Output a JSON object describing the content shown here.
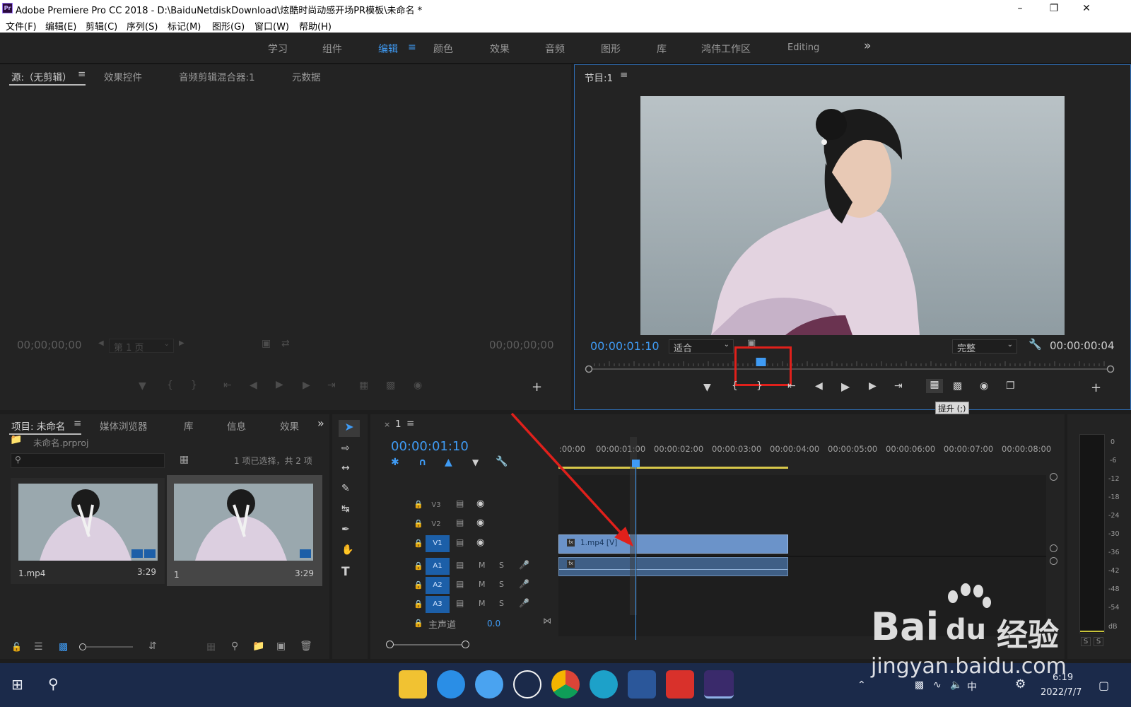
{
  "window": {
    "title": "Adobe Premiere Pro CC 2018 - D:\\BaiduNetdiskDownload\\炫酷时尚动感开场PR模板\\未命名 *",
    "app_icon": "Pr"
  },
  "menu": [
    "文件(F)",
    "编辑(E)",
    "剪辑(C)",
    "序列(S)",
    "标记(M)",
    "图形(G)",
    "窗口(W)",
    "帮助(H)"
  ],
  "workspaces": {
    "items": [
      "学习",
      "组件",
      "编辑",
      "颜色",
      "效果",
      "音频",
      "图形",
      "库",
      "鸿伟工作区",
      "Editing"
    ],
    "active": "编辑",
    "more": "»"
  },
  "source_panel": {
    "tabs": [
      "源:（无剪辑）",
      "效果控件",
      "音频剪辑混合器:1",
      "元数据"
    ],
    "tc_left": "00;00;00;00",
    "tc_right": "00;00;00;00",
    "page_select": "第 1 页",
    "add": "+"
  },
  "program_panel": {
    "title": "节目:1",
    "timecode": "00:00:01:10",
    "fit": "适合",
    "quality": "完整",
    "duration": "00:00:00:04",
    "tooltip": "提升 (;)",
    "add": "+",
    "playhead_fraction": 0.33
  },
  "project_panel": {
    "tabs": [
      "项目: 未命名",
      "媒体浏览器",
      "库",
      "信息",
      "效果"
    ],
    "file": "未命名.prproj",
    "selection_status": "1 项已选择，共 2 项",
    "search_placeholder": "",
    "items": [
      {
        "name": "1.mp4",
        "duration": "3:29"
      },
      {
        "name": "1",
        "duration": "3:29"
      }
    ]
  },
  "timeline": {
    "tab": "1",
    "timecode": "00:00:01:10",
    "ruler_labels": [
      ":00:00",
      "00:00:01:00",
      "00:00:02:00",
      "00:00:03:00",
      "00:00:04:00",
      "00:00:05:00",
      "00:00:06:00",
      "00:00:07:00",
      "00:00:08:00"
    ],
    "video_tracks": [
      "V3",
      "V2",
      "V1"
    ],
    "audio_tracks": [
      "A1",
      "A2",
      "A3"
    ],
    "m_label": "M",
    "s_label": "S",
    "master": {
      "label": "主声道",
      "value": "0.0"
    },
    "clip_video": "1.mp4 [V]",
    "clip_audio": "fx"
  },
  "meter": {
    "labels": [
      "0",
      "-6",
      "-12",
      "-18",
      "-24",
      "-30",
      "-36",
      "-42",
      "-48",
      "-54",
      "dB"
    ],
    "solo": [
      "S",
      "S"
    ]
  },
  "taskbar": {
    "time": "6:19",
    "date": "2022/7/7",
    "ime": "中"
  },
  "watermark": {
    "brand": "Bai",
    "brand2": "du",
    "cn": "经验",
    "url": "jingyan.baidu.com"
  },
  "colors": {
    "accent": "#3f9bf4",
    "annotation": "#e0201b",
    "clip": "#6b93c9"
  }
}
